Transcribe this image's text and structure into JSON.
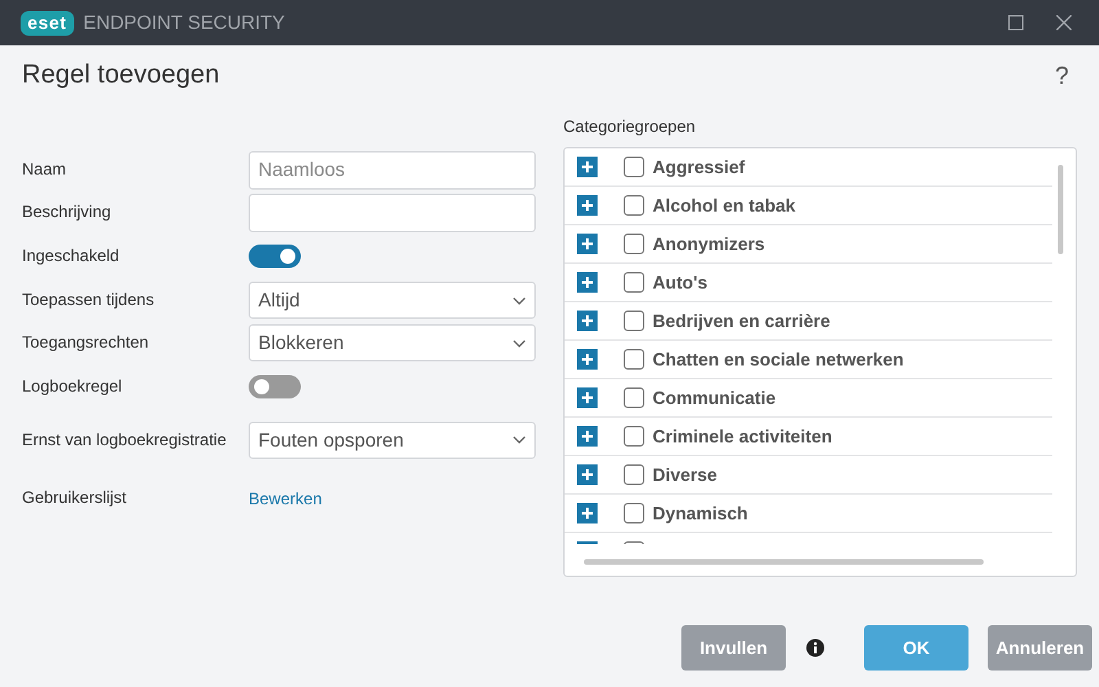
{
  "window": {
    "brand": "eset",
    "product": "ENDPOINT SECURITY"
  },
  "dialog": {
    "title": "Regel toevoegen",
    "help": "?"
  },
  "form": [
    {
      "kind": "text",
      "label": "Naam",
      "placeholder": "Naamloos"
    },
    {
      "kind": "text",
      "label": "Beschrijving"
    },
    {
      "kind": "toggle",
      "label": "Ingeschakeld",
      "on": true
    },
    {
      "kind": "select",
      "label": "Toepassen tijdens",
      "value": "Altijd"
    },
    {
      "kind": "select",
      "label": "Toegangsrechten",
      "value": "Blokkeren"
    },
    {
      "kind": "toggle",
      "label": "Logboekregel",
      "on": false
    },
    {
      "kind": "select",
      "label": "Ernst van logboekregistratie",
      "value": "Fouten opsporen"
    },
    {
      "kind": "link",
      "label": "Gebruikerslijst",
      "value": "Bewerken"
    }
  ],
  "categories": {
    "title": "Categoriegroepen",
    "items": [
      {
        "label": "Aggressief",
        "checked": false
      },
      {
        "label": "Alcohol en tabak",
        "checked": false
      },
      {
        "label": "Anonymizers",
        "checked": false
      },
      {
        "label": "Auto's",
        "checked": false
      },
      {
        "label": "Bedrijven en carrière",
        "checked": false
      },
      {
        "label": "Chatten en sociale netwerken",
        "checked": false
      },
      {
        "label": "Communicatie",
        "checked": false
      },
      {
        "label": "Criminele activiteiten",
        "checked": false
      },
      {
        "label": "Diverse",
        "checked": false
      },
      {
        "label": "Dynamisch",
        "checked": false
      },
      {
        "checked": false
      }
    ]
  },
  "buttons": [
    {
      "kind": "secondary",
      "label": "Invullen"
    },
    {
      "kind": "info"
    },
    {
      "kind": "primary",
      "label": "OK"
    },
    {
      "kind": "secondary",
      "label": "Annuleren"
    }
  ]
}
